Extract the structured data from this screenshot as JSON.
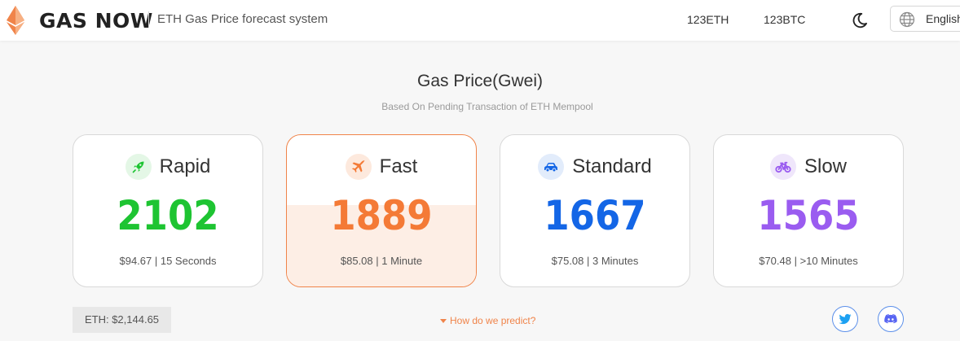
{
  "header": {
    "brand": "GAS NOW",
    "tagline": "ETH Gas Price forecast system",
    "nav": [
      {
        "label": "123ETH"
      },
      {
        "label": "123BTC"
      }
    ],
    "theme_icon": "moon-icon",
    "language": {
      "icon": "globe-icon",
      "label": "English"
    }
  },
  "main": {
    "title": "Gas Price(Gwei)",
    "subtitle": "Based On Pending Transaction of ETH Mempool",
    "cards": [
      {
        "label": "Rapid",
        "value": "2102",
        "sub": "$94.67 | 15 Seconds",
        "icon": "rocket-icon",
        "color": "#1ec432",
        "icon_bg": "#e4f7e6",
        "selected": false
      },
      {
        "label": "Fast",
        "value": "1889",
        "sub": "$85.08 | 1 Minute",
        "icon": "airplane-icon",
        "color": "#f47a36",
        "icon_bg": "#fde9dd",
        "selected": true
      },
      {
        "label": "Standard",
        "value": "1667",
        "sub": "$75.08 | 3 Minutes",
        "icon": "car-icon",
        "color": "#1466e6",
        "icon_bg": "#e2ecfb",
        "selected": false
      },
      {
        "label": "Slow",
        "value": "1565",
        "sub": "$70.48 | >10 Minutes",
        "icon": "bicycle-icon",
        "color": "#9a5cf0",
        "icon_bg": "#efe6fb",
        "selected": false
      }
    ]
  },
  "footer": {
    "eth_price": "ETH: $2,144.65",
    "predict_link": "How do we predict?",
    "social": [
      {
        "icon": "twitter-icon"
      },
      {
        "icon": "discord-icon"
      }
    ]
  },
  "colors": {
    "accent": "#f0844a",
    "social": "#5b8fea"
  }
}
